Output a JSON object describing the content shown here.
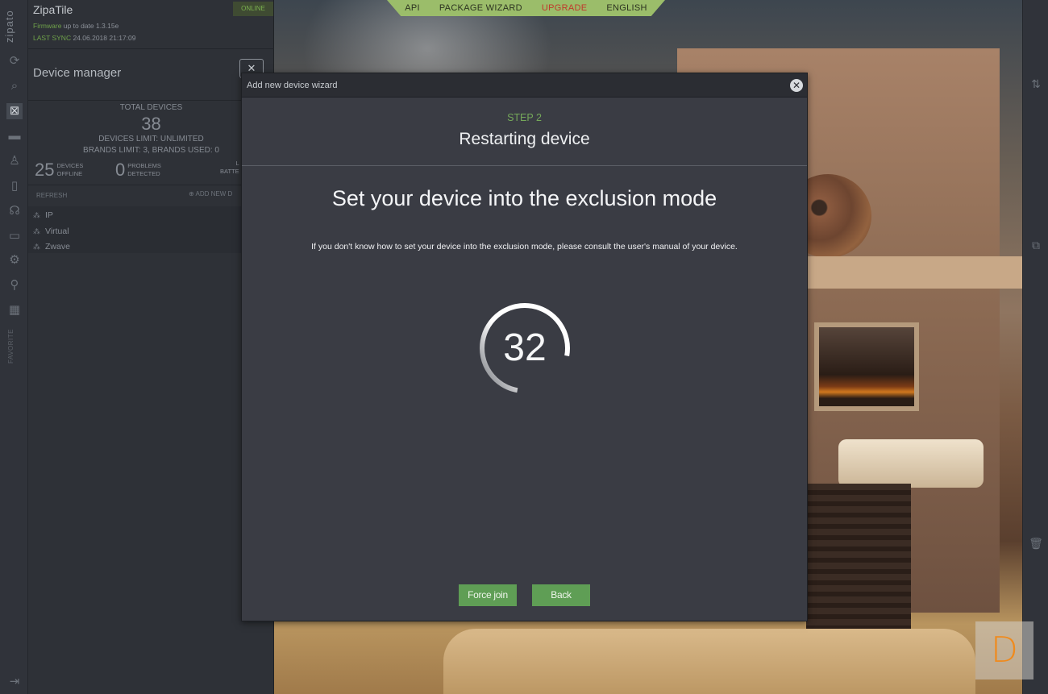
{
  "colors": {
    "accent_green": "#5f9e55",
    "step_green": "#75a85a",
    "upgrade_red": "#c0392b",
    "nav_green": "#9bbd6a",
    "logo_orange": "#f08a1c"
  },
  "topnav": {
    "items": [
      "API",
      "PACKAGE WIZARD",
      "UPGRADE",
      "ENGLISH"
    ]
  },
  "rail": {
    "brand": "zipato",
    "favorite_label": "FAVORITE",
    "icons": [
      "sync-icon",
      "search-icon",
      "devices-icon",
      "scenes-icon",
      "users-icon",
      "rules-icon",
      "support-icon",
      "folder-icon",
      "settings-icon",
      "location-icon",
      "calendar-icon",
      "logout-icon"
    ]
  },
  "panel": {
    "hub_name": "ZipaTile",
    "status": "ONLINE",
    "firmware_label": "Firmware",
    "firmware_text": "up to date 1.3.15e",
    "last_sync_label": "LAST SYNC",
    "last_sync_value": "24.06.2018 21:17:09",
    "title": "Device manager",
    "total_label": "TOTAL DEVICES",
    "total_value": "38",
    "devices_limit": "DEVICES LIMIT: UNLIMITED",
    "brands_limit": "BRANDS LIMIT: 3, BRANDS USED: 0",
    "stats": [
      {
        "value": "25",
        "line1": "DEVICES",
        "line2": "OFFLINE"
      },
      {
        "value": "0",
        "line1": "PROBLEMS",
        "line2": "DETECTED"
      },
      {
        "value": "",
        "line1": "L",
        "line2": "BATTE"
      }
    ],
    "refresh": "REFRESH",
    "add_new": "ADD NEW D",
    "tree": [
      "IP",
      "Virtual",
      "Zwave"
    ]
  },
  "modal": {
    "title": "Add new device wizard",
    "step": "STEP 2",
    "step_title": "Restarting device",
    "heading": "Set your device into the exclusion mode",
    "help": "If you don't know how to set your device into the exclusion mode, please consult the user's manual of your device.",
    "countdown": "32",
    "countdown_fraction": 0.75,
    "buttons": {
      "force_join": "Force join",
      "back": "Back"
    }
  },
  "badge": {
    "letter": "D"
  }
}
